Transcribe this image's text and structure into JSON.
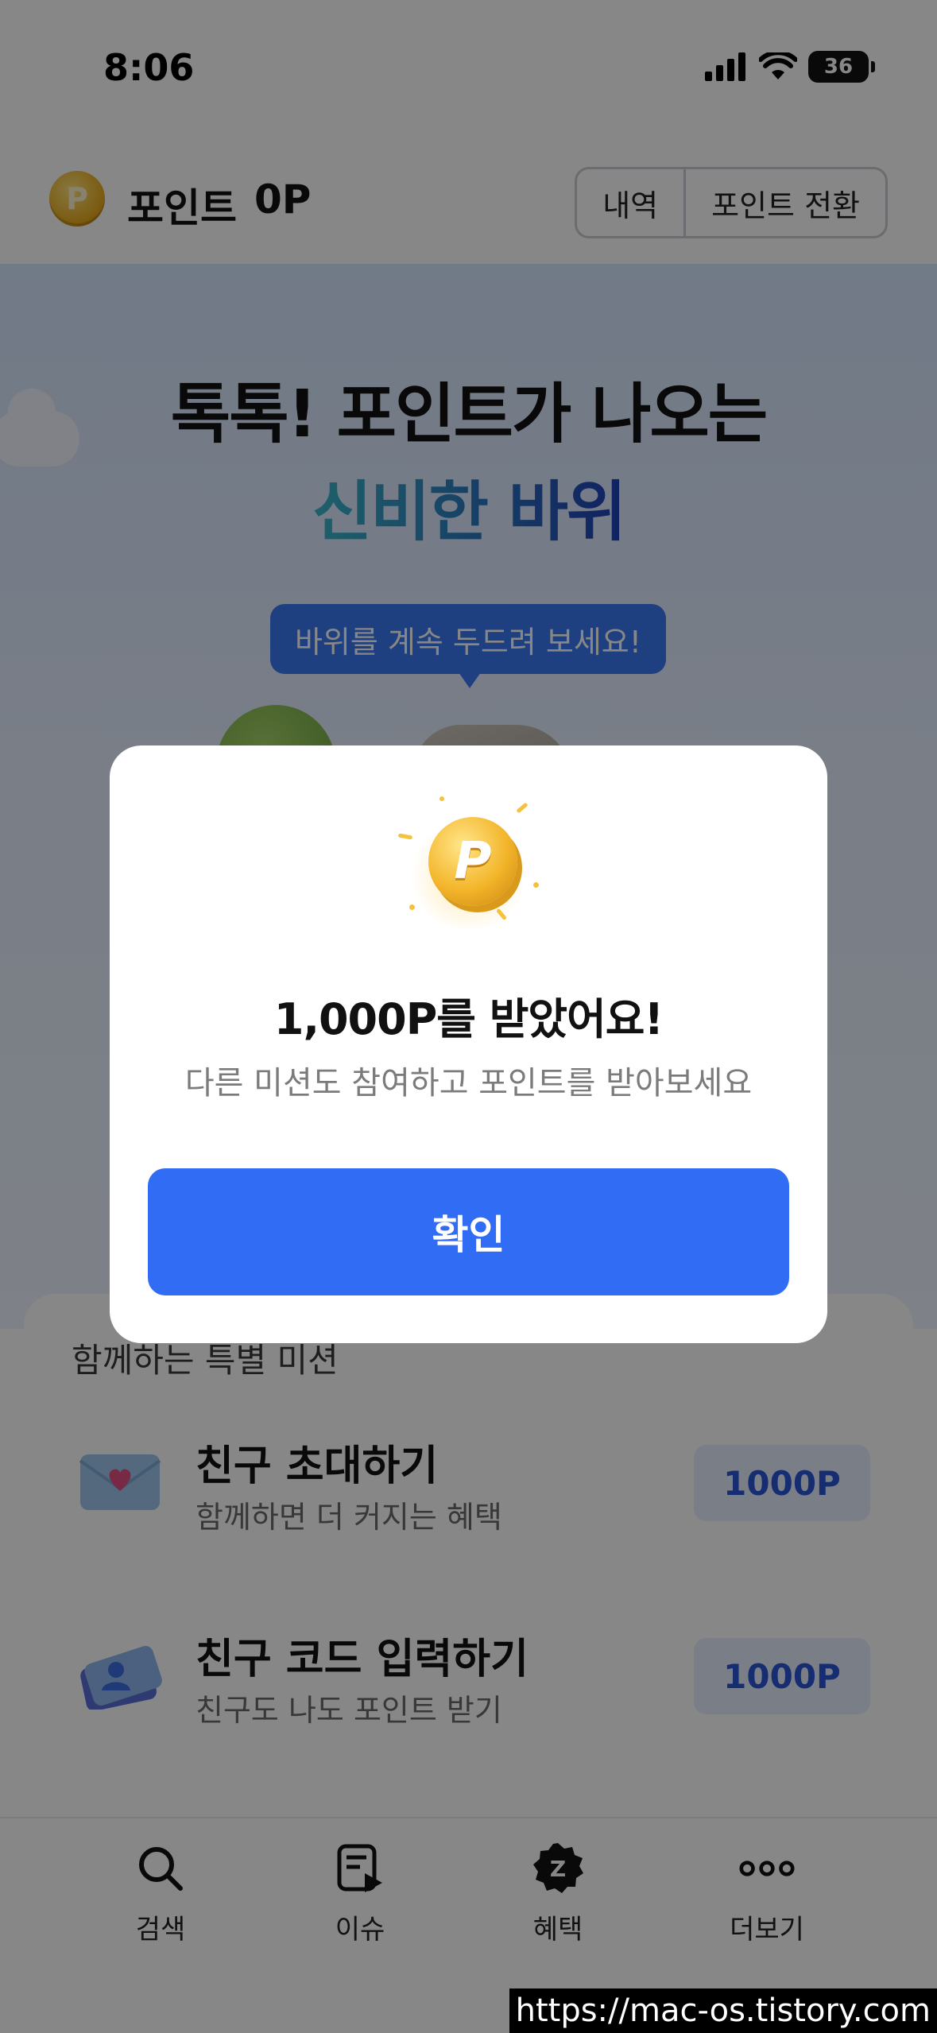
{
  "status_bar": {
    "time": "8:06",
    "battery": "36"
  },
  "header": {
    "title": "포인트",
    "points": "0P",
    "history_label": "내역",
    "convert_label": "포인트 전환",
    "coin_letter": "P"
  },
  "hero": {
    "line1": "톡톡! 포인트가 나오는",
    "line2": "신비한 바위",
    "tooltip": "바위를 계속 두드려 보세요!"
  },
  "missions": {
    "title": "함께하는 특별 미션",
    "items": [
      {
        "name": "친구 초대하기",
        "sub": "함께하면 더 커지는 혜택",
        "reward": "1000P"
      },
      {
        "name": "친구 코드 입력하기",
        "sub": "친구도 나도 포인트 받기",
        "reward": "1000P"
      }
    ]
  },
  "tabbar": {
    "items": [
      {
        "label": "검색"
      },
      {
        "label": "이슈"
      },
      {
        "label": "혜택"
      },
      {
        "label": "더보기"
      }
    ]
  },
  "modal": {
    "coin_letter": "P",
    "title": "1,000P를 받았어요!",
    "subtitle": "다른 미션도 참여하고 포인트를 받아보세요",
    "confirm_label": "확인"
  },
  "watermark": "https://mac-os.tistory.com",
  "colors": {
    "accent": "#316cf4",
    "overlay": "rgba(0,0,0,0.47)",
    "reward_text": "#2a55d6",
    "coin": "#f3b52a"
  }
}
